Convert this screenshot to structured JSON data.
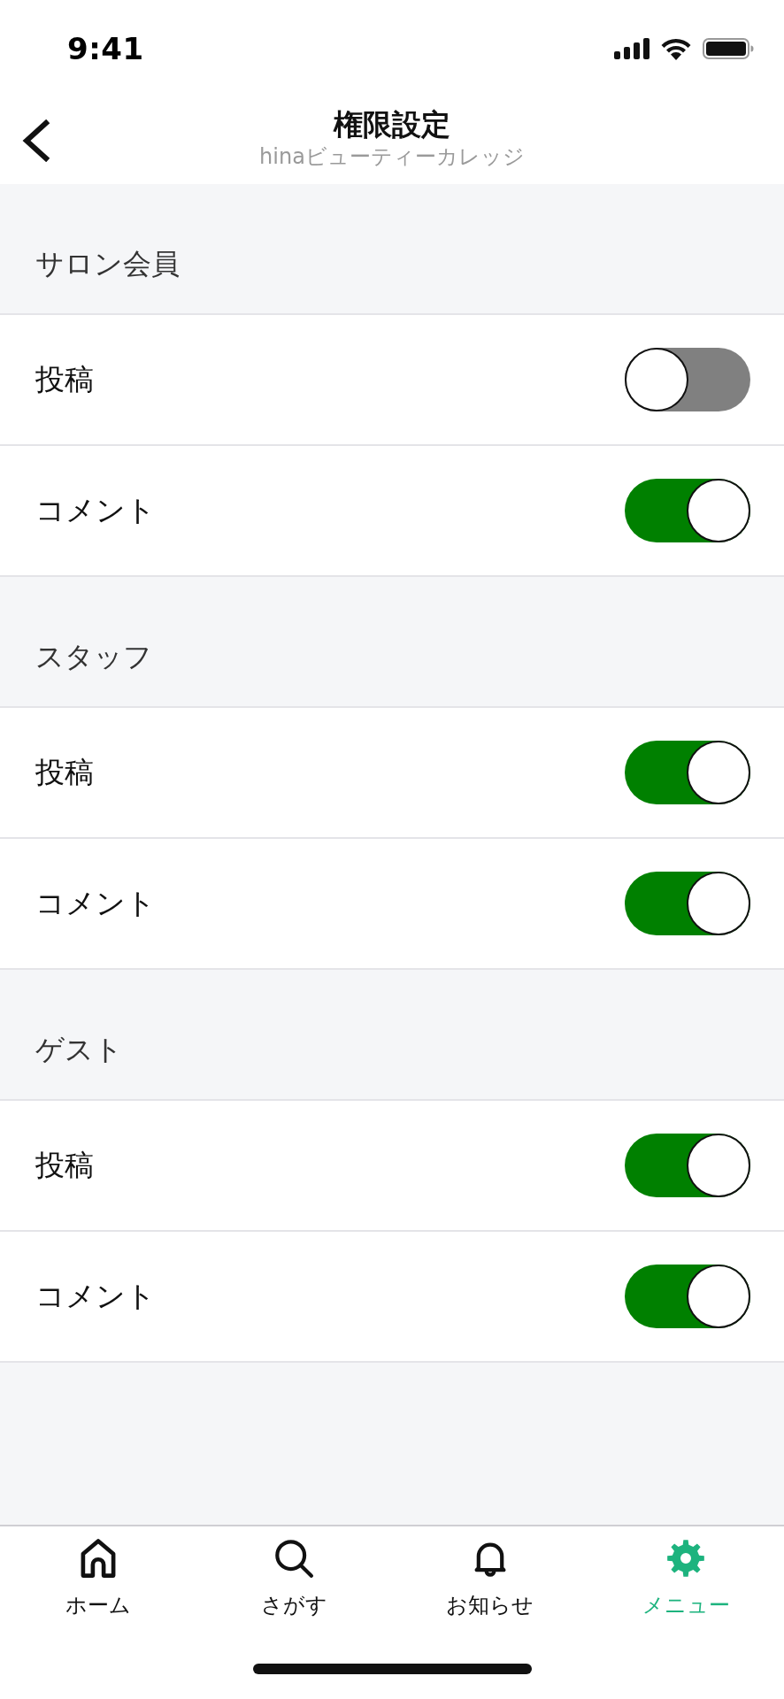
{
  "status_bar": {
    "time": "9:41"
  },
  "header": {
    "title": "権限設定",
    "subtitle": "hinaビューティーカレッジ"
  },
  "sections": [
    {
      "title": "サロン会員",
      "items": [
        {
          "label": "投稿",
          "on": false
        },
        {
          "label": "コメント",
          "on": true
        }
      ]
    },
    {
      "title": "スタッフ",
      "items": [
        {
          "label": "投稿",
          "on": true
        },
        {
          "label": "コメント",
          "on": true
        }
      ]
    },
    {
      "title": "ゲスト",
      "items": [
        {
          "label": "投稿",
          "on": true
        },
        {
          "label": "コメント",
          "on": true
        }
      ]
    }
  ],
  "tab_bar": {
    "tabs": [
      {
        "label": "ホーム",
        "selected": false
      },
      {
        "label": "さがす",
        "selected": false
      },
      {
        "label": "お知らせ",
        "selected": false
      },
      {
        "label": "メニュー",
        "selected": true
      }
    ]
  }
}
